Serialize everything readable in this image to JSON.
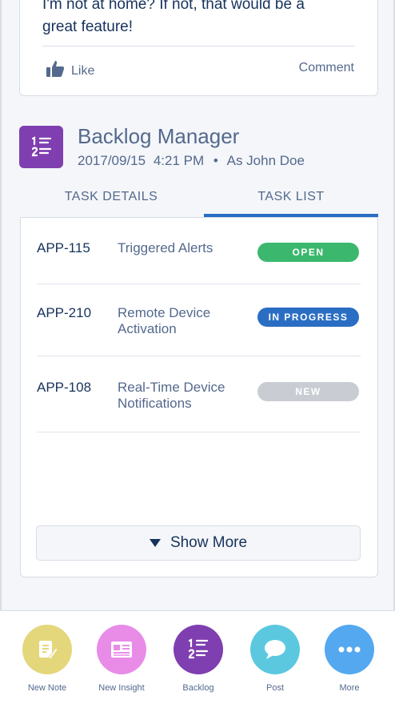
{
  "post": {
    "text_line1": "I'm not at home? If not, that would be a",
    "text_line2": "great feature!",
    "like_label": "Like",
    "comment_label": "Comment"
  },
  "app_card": {
    "title": "Backlog Manager",
    "date": "2017/09/15",
    "time": "4:21 PM",
    "separator": "•",
    "author": "As John Doe",
    "icon": "backlog-list-icon",
    "icon_color": "#7f3fb0"
  },
  "tabs": [
    {
      "label": "TASK DETAILS",
      "active": false
    },
    {
      "label": "TASK LIST",
      "active": true
    }
  ],
  "tasks": [
    {
      "id": "APP-115",
      "name": "Triggered Alerts",
      "status": "OPEN",
      "status_color": "#3cb86e"
    },
    {
      "id": "APP-210",
      "name": "Remote Device Activation",
      "status": "IN PROGRESS",
      "status_color": "#2a6ec4"
    },
    {
      "id": "APP-108",
      "name": "Real-Time Device Notifications",
      "status": "NEW",
      "status_color": "#c9cdd3"
    }
  ],
  "show_more_label": "Show More",
  "actions": [
    {
      "label": "New Note",
      "icon": "note-icon",
      "color": "#e4d67a"
    },
    {
      "label": "New Insight",
      "icon": "insight-icon",
      "color": "#e88ce8"
    },
    {
      "label": "Backlog",
      "icon": "backlog-icon",
      "color": "#7f3fb0"
    },
    {
      "label": "Post",
      "icon": "post-icon",
      "color": "#5bc8e0"
    },
    {
      "label": "More",
      "icon": "more-icon",
      "color": "#54a8f0"
    }
  ]
}
